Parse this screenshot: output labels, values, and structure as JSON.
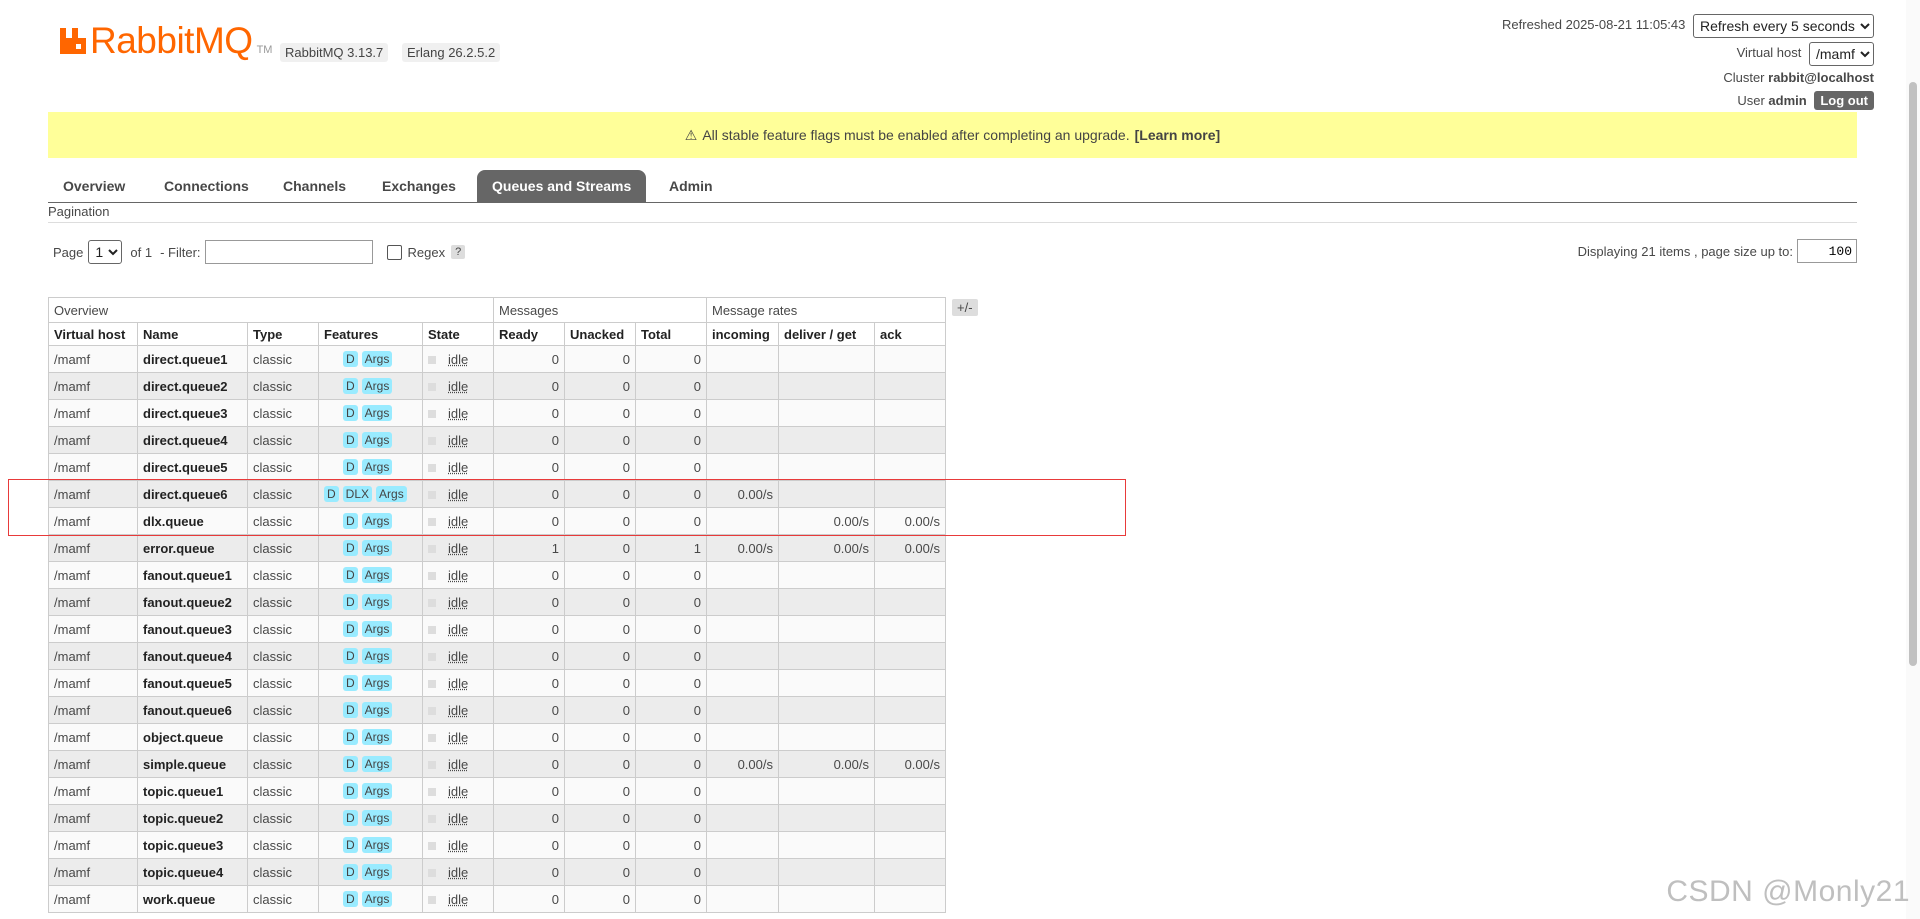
{
  "header": {
    "brand": "RabbitMQ",
    "tm": "TM",
    "version": "RabbitMQ 3.13.7",
    "erlang": "Erlang 26.2.5.2",
    "refreshed_label": "Refreshed 2025-08-21 11:05:43",
    "refresh_select": "Refresh every 5 seconds",
    "vhost_label": "Virtual host",
    "vhost_value": "/mamf",
    "cluster_label": "Cluster",
    "cluster_value": "rabbit@localhost",
    "user_label": "User",
    "user_value": "admin",
    "logout": "Log out"
  },
  "flag_bar": {
    "message": "All stable feature flags must be enabled after completing an upgrade.",
    "learn_more": "[Learn more]"
  },
  "tabs": [
    "Overview",
    "Connections",
    "Channels",
    "Exchanges",
    "Queues and Streams",
    "Admin"
  ],
  "active_tab": "Queues and Streams",
  "section_title": "Pagination",
  "pagination": {
    "page_label": "Page",
    "page_value": "1",
    "of_label": "of 1",
    "filter_label": "- Filter:",
    "regex_label": "Regex",
    "help": "?",
    "display_text": "Displaying 21 items , page size up to:",
    "page_size": "100"
  },
  "table": {
    "group_headers": [
      "Overview",
      "Messages",
      "Message rates"
    ],
    "toggle": "+/-",
    "columns": [
      "Virtual host",
      "Name",
      "Type",
      "Features",
      "State",
      "Ready",
      "Unacked",
      "Total",
      "incoming",
      "deliver / get",
      "ack"
    ],
    "rows": [
      {
        "vhost": "/mamf",
        "name": "direct.queue1",
        "type": "classic",
        "features": [
          "D",
          "Args"
        ],
        "state": "idle",
        "ready": "0",
        "unacked": "0",
        "total": "0",
        "incoming": "",
        "deliver": "",
        "ack": ""
      },
      {
        "vhost": "/mamf",
        "name": "direct.queue2",
        "type": "classic",
        "features": [
          "D",
          "Args"
        ],
        "state": "idle",
        "ready": "0",
        "unacked": "0",
        "total": "0",
        "incoming": "",
        "deliver": "",
        "ack": ""
      },
      {
        "vhost": "/mamf",
        "name": "direct.queue3",
        "type": "classic",
        "features": [
          "D",
          "Args"
        ],
        "state": "idle",
        "ready": "0",
        "unacked": "0",
        "total": "0",
        "incoming": "",
        "deliver": "",
        "ack": ""
      },
      {
        "vhost": "/mamf",
        "name": "direct.queue4",
        "type": "classic",
        "features": [
          "D",
          "Args"
        ],
        "state": "idle",
        "ready": "0",
        "unacked": "0",
        "total": "0",
        "incoming": "",
        "deliver": "",
        "ack": ""
      },
      {
        "vhost": "/mamf",
        "name": "direct.queue5",
        "type": "classic",
        "features": [
          "D",
          "Args"
        ],
        "state": "idle",
        "ready": "0",
        "unacked": "0",
        "total": "0",
        "incoming": "",
        "deliver": "",
        "ack": ""
      },
      {
        "vhost": "/mamf",
        "name": "direct.queue6",
        "type": "classic",
        "features": [
          "D",
          "DLX",
          "Args"
        ],
        "state": "idle",
        "ready": "0",
        "unacked": "0",
        "total": "0",
        "incoming": "0.00/s",
        "deliver": "",
        "ack": ""
      },
      {
        "vhost": "/mamf",
        "name": "dlx.queue",
        "type": "classic",
        "features": [
          "D",
          "Args"
        ],
        "state": "idle",
        "ready": "0",
        "unacked": "0",
        "total": "0",
        "incoming": "",
        "deliver": "0.00/s",
        "ack": "0.00/s"
      },
      {
        "vhost": "/mamf",
        "name": "error.queue",
        "type": "classic",
        "features": [
          "D",
          "Args"
        ],
        "state": "idle",
        "ready": "1",
        "unacked": "0",
        "total": "1",
        "incoming": "0.00/s",
        "deliver": "0.00/s",
        "ack": "0.00/s"
      },
      {
        "vhost": "/mamf",
        "name": "fanout.queue1",
        "type": "classic",
        "features": [
          "D",
          "Args"
        ],
        "state": "idle",
        "ready": "0",
        "unacked": "0",
        "total": "0",
        "incoming": "",
        "deliver": "",
        "ack": ""
      },
      {
        "vhost": "/mamf",
        "name": "fanout.queue2",
        "type": "classic",
        "features": [
          "D",
          "Args"
        ],
        "state": "idle",
        "ready": "0",
        "unacked": "0",
        "total": "0",
        "incoming": "",
        "deliver": "",
        "ack": ""
      },
      {
        "vhost": "/mamf",
        "name": "fanout.queue3",
        "type": "classic",
        "features": [
          "D",
          "Args"
        ],
        "state": "idle",
        "ready": "0",
        "unacked": "0",
        "total": "0",
        "incoming": "",
        "deliver": "",
        "ack": ""
      },
      {
        "vhost": "/mamf",
        "name": "fanout.queue4",
        "type": "classic",
        "features": [
          "D",
          "Args"
        ],
        "state": "idle",
        "ready": "0",
        "unacked": "0",
        "total": "0",
        "incoming": "",
        "deliver": "",
        "ack": ""
      },
      {
        "vhost": "/mamf",
        "name": "fanout.queue5",
        "type": "classic",
        "features": [
          "D",
          "Args"
        ],
        "state": "idle",
        "ready": "0",
        "unacked": "0",
        "total": "0",
        "incoming": "",
        "deliver": "",
        "ack": ""
      },
      {
        "vhost": "/mamf",
        "name": "fanout.queue6",
        "type": "classic",
        "features": [
          "D",
          "Args"
        ],
        "state": "idle",
        "ready": "0",
        "unacked": "0",
        "total": "0",
        "incoming": "",
        "deliver": "",
        "ack": ""
      },
      {
        "vhost": "/mamf",
        "name": "object.queue",
        "type": "classic",
        "features": [
          "D",
          "Args"
        ],
        "state": "idle",
        "ready": "0",
        "unacked": "0",
        "total": "0",
        "incoming": "",
        "deliver": "",
        "ack": ""
      },
      {
        "vhost": "/mamf",
        "name": "simple.queue",
        "type": "classic",
        "features": [
          "D",
          "Args"
        ],
        "state": "idle",
        "ready": "0",
        "unacked": "0",
        "total": "0",
        "incoming": "0.00/s",
        "deliver": "0.00/s",
        "ack": "0.00/s"
      },
      {
        "vhost": "/mamf",
        "name": "topic.queue1",
        "type": "classic",
        "features": [
          "D",
          "Args"
        ],
        "state": "idle",
        "ready": "0",
        "unacked": "0",
        "total": "0",
        "incoming": "",
        "deliver": "",
        "ack": ""
      },
      {
        "vhost": "/mamf",
        "name": "topic.queue2",
        "type": "classic",
        "features": [
          "D",
          "Args"
        ],
        "state": "idle",
        "ready": "0",
        "unacked": "0",
        "total": "0",
        "incoming": "",
        "deliver": "",
        "ack": ""
      },
      {
        "vhost": "/mamf",
        "name": "topic.queue3",
        "type": "classic",
        "features": [
          "D",
          "Args"
        ],
        "state": "idle",
        "ready": "0",
        "unacked": "0",
        "total": "0",
        "incoming": "",
        "deliver": "",
        "ack": ""
      },
      {
        "vhost": "/mamf",
        "name": "topic.queue4",
        "type": "classic",
        "features": [
          "D",
          "Args"
        ],
        "state": "idle",
        "ready": "0",
        "unacked": "0",
        "total": "0",
        "incoming": "",
        "deliver": "",
        "ack": ""
      },
      {
        "vhost": "/mamf",
        "name": "work.queue",
        "type": "classic",
        "features": [
          "D",
          "Args"
        ],
        "state": "idle",
        "ready": "0",
        "unacked": "0",
        "total": "0",
        "incoming": "",
        "deliver": "",
        "ack": ""
      }
    ]
  },
  "watermark": "CSDN @Monly21",
  "colors": {
    "brand": "#ff6600",
    "flag_bar": "#ffff99",
    "feature_badge": "#99ebff",
    "tab_active": "#666666",
    "highlight_box": "#e83a3a"
  }
}
